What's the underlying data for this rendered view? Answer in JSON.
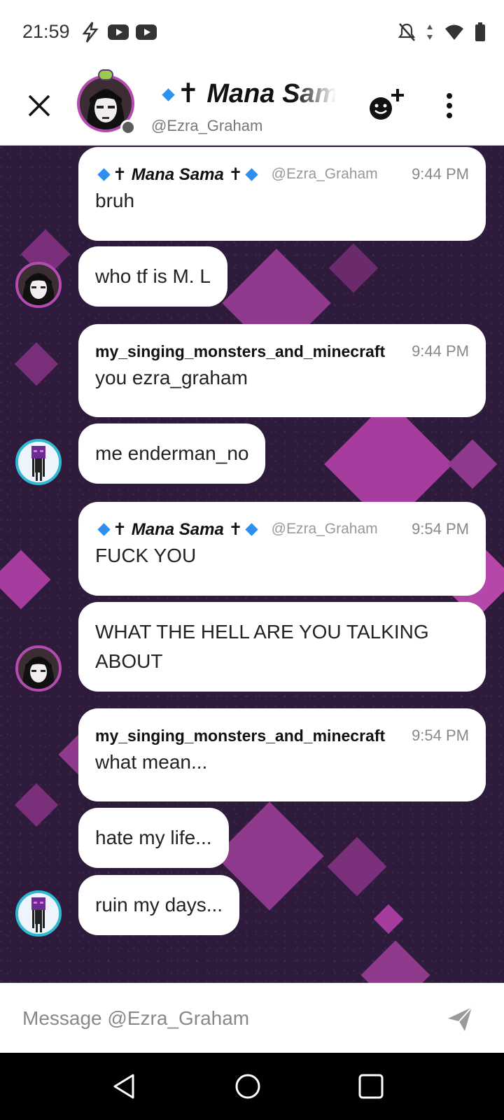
{
  "status_bar": {
    "time": "21:59",
    "left_icons": [
      "flash-icon",
      "youtube-icon",
      "youtube-icon"
    ],
    "right_icons": [
      "notifications-off-icon",
      "data-arrows-icon",
      "wifi-icon",
      "battery-icon"
    ]
  },
  "header": {
    "display_name": "✝ Mana Sama ✝",
    "handle": "@Ezra_Graham",
    "online_status": "offline",
    "accent_color": "#2f8ff0"
  },
  "messages": [
    {
      "sender": "✝ Mana Sama ✝",
      "handle": "@Ezra_Graham",
      "time": "9:44 PM",
      "lines": [
        "bruh"
      ]
    },
    {
      "lines": [
        "who tf is M. L"
      ]
    },
    {
      "sender": "my_singing_monsters_and_minecraft",
      "time": "9:44 PM",
      "lines": [
        "you ezra_graham"
      ]
    },
    {
      "lines": [
        "me enderman_no"
      ]
    },
    {
      "sender": "✝ Mana Sama ✝",
      "handle": "@Ezra_Graham",
      "time": "9:54 PM",
      "lines": [
        "FUCK YOU"
      ]
    },
    {
      "lines": [
        "WHAT THE HELL ARE YOU TALKING ABOUT"
      ]
    },
    {
      "sender": "my_singing_monsters_and_minecraft",
      "time": "9:54 PM",
      "lines": [
        "what mean..."
      ]
    },
    {
      "lines": [
        "hate my life..."
      ]
    },
    {
      "lines": [
        "ruin my days..."
      ]
    }
  ],
  "composer": {
    "placeholder": "Message @Ezra_Graham"
  },
  "colors": {
    "chat_background": "#2e1a3a",
    "pattern_accent": "#a63c9e",
    "mana_frame": "#b34bb0",
    "ender_frame": "#2fb9d2"
  }
}
